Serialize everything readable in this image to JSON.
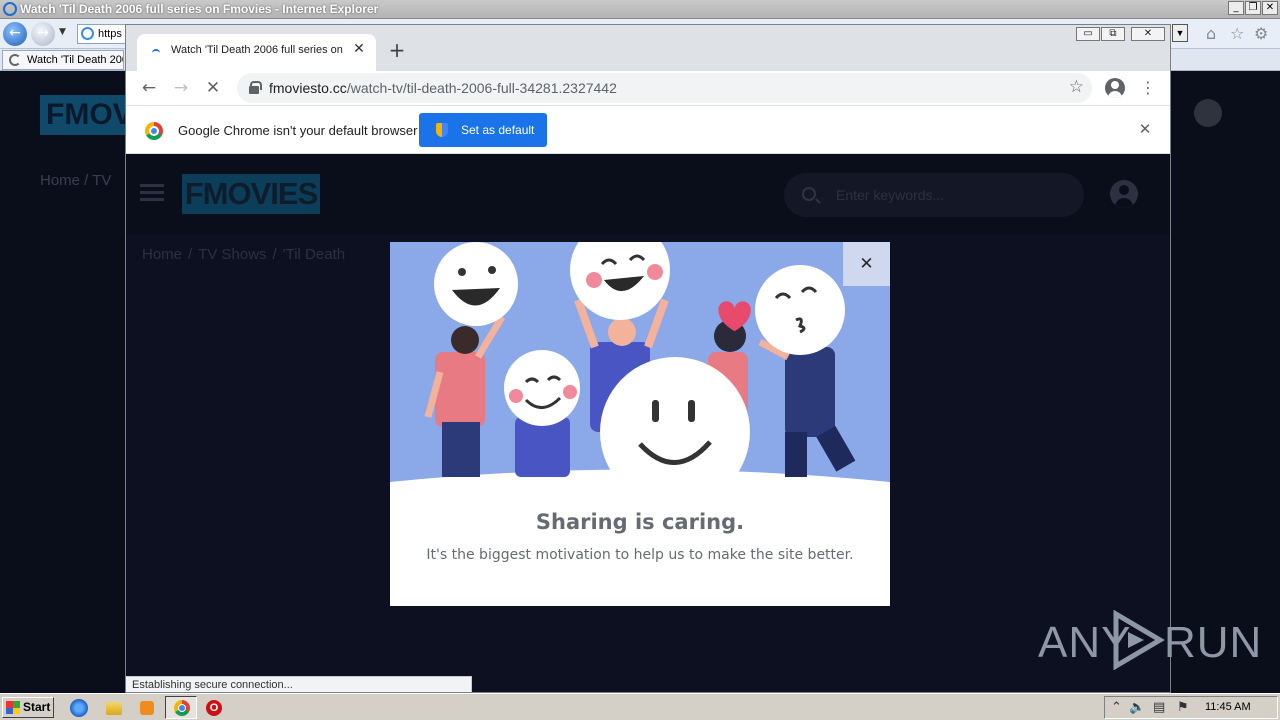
{
  "ie": {
    "title": "Watch 'Til Death 2006 full series on Fmovies - Internet Explorer",
    "address_text": "https",
    "tab_title": "Watch 'Til Death 2006 ...",
    "controls": {
      "minimize": "_",
      "restore": "❐",
      "close": "✕"
    }
  },
  "chrome": {
    "tab_title": "Watch 'Til Death 2006 full series on Fmovies",
    "tab_close": "✕",
    "new_tab": "+",
    "url_host": "fmoviesto.cc",
    "url_path": "/watch-tv/til-death-2006-full-34281.2327442",
    "infobar_text": "Google Chrome isn't your default browser",
    "infobar_button": "Set as default",
    "infobar_close": "✕",
    "status_text": "Establishing secure connection...",
    "win_controls": {
      "minimize": "▭",
      "restore": "⧉",
      "close": "✕"
    }
  },
  "site": {
    "logo": "FMOVIES",
    "search_placeholder": "Enter keywords...",
    "breadcrumb": [
      "Home",
      "TV Shows",
      "'Til Death"
    ],
    "breadcrumb_sep": "/",
    "bg_breadcrumb": "Home  /  TV"
  },
  "modal": {
    "title": "Sharing is caring.",
    "subtitle": "It's the biggest motivation to help us to make the site better.",
    "close": "✕"
  },
  "watermark": {
    "left": "ANY",
    "right": "RUN"
  },
  "taskbar": {
    "start": "Start",
    "clock": "11:45 AM"
  },
  "colors": {
    "site_bg": "#0a0e1b",
    "modal_art_bg": "#8ba8e8",
    "chrome_blue": "#1a73e8"
  }
}
